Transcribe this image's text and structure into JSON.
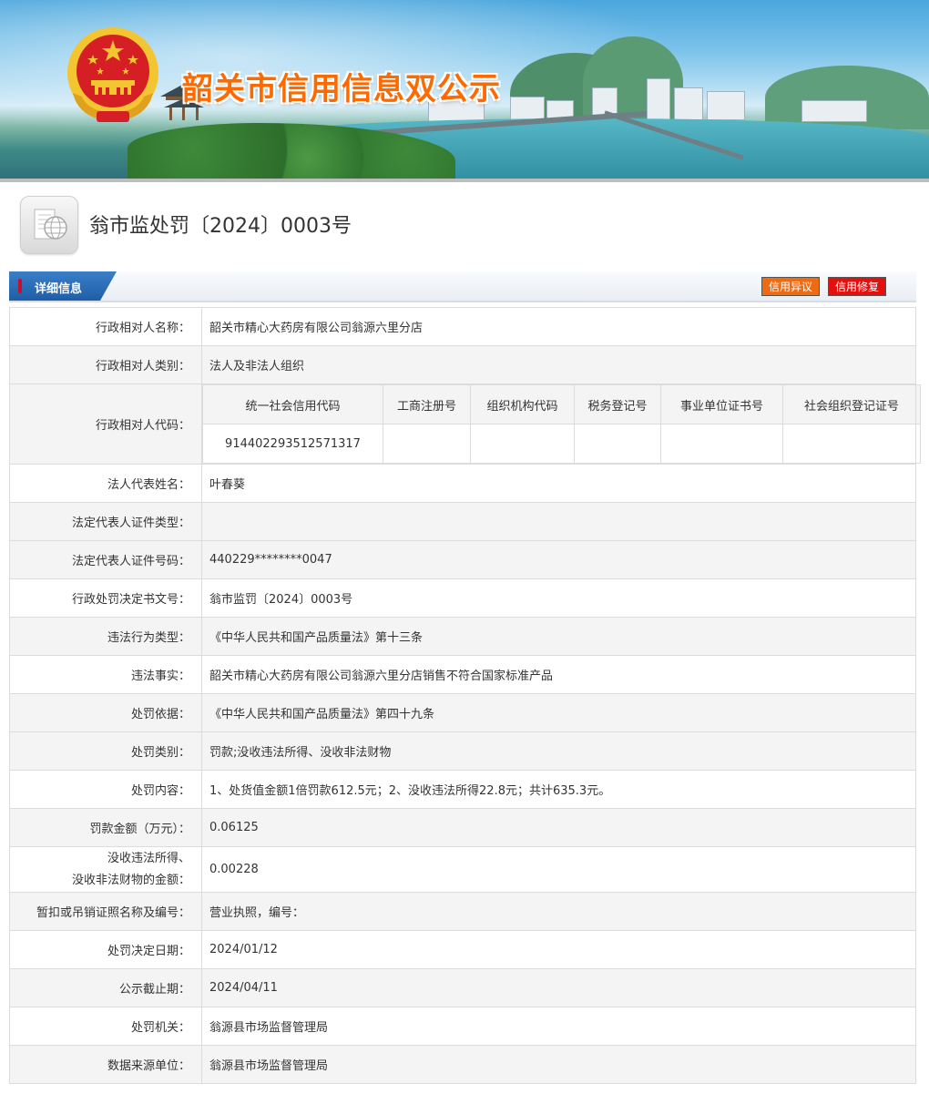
{
  "banner": {
    "title": "韶关市信用信息双公示"
  },
  "page": {
    "title": "翁市监处罚〔2024〕0003号"
  },
  "section": {
    "tab_label": "详细信息",
    "btn_objection": "信用异议",
    "btn_repair": "信用修复"
  },
  "code_table": {
    "headers": [
      "统一社会信用代码",
      "工商注册号",
      "组织机构代码",
      "税务登记号",
      "事业单位证书号",
      "社会组织登记证号"
    ],
    "values": [
      "914402293512571317",
      "",
      "",
      "",
      "",
      ""
    ]
  },
  "rows": [
    {
      "label": "行政相对人名称：",
      "value": "韶关市精心大药房有限公司翁源六里分店"
    },
    {
      "label": "行政相对人类别：",
      "value": "法人及非法人组织"
    },
    {
      "label": "行政相对人代码：",
      "value": ""
    },
    {
      "label": "法人代表姓名：",
      "value": "叶春葵"
    },
    {
      "label": "法定代表人证件类型：",
      "value": ""
    },
    {
      "label": "法定代表人证件号码：",
      "value": "440229********0047"
    },
    {
      "label": "行政处罚决定书文号：",
      "value": "翁市监罚〔2024〕0003号"
    },
    {
      "label": "违法行为类型：",
      "value": "《中华人民共和国产品质量法》第十三条"
    },
    {
      "label": "违法事实：",
      "value": "韶关市精心大药房有限公司翁源六里分店销售不符合国家标准产品"
    },
    {
      "label": "处罚依据：",
      "value": "《中华人民共和国产品质量法》第四十九条"
    },
    {
      "label": "处罚类别：",
      "value": "罚款;没收违法所得、没收非法财物"
    },
    {
      "label": "处罚内容：",
      "value": "1、处货值金额1倍罚款612.5元；2、没收违法所得22.8元；共计635.3元。"
    },
    {
      "label": "罚款金额（万元）：",
      "value": "0.06125"
    },
    {
      "label": "没收违法所得、",
      "label2": "没收非法财物的金额：",
      "value": "0.00228"
    },
    {
      "label": "暂扣或吊销证照名称及编号：",
      "value": "营业执照，编号："
    },
    {
      "label": "处罚决定日期：",
      "value": "2024/01/12"
    },
    {
      "label": "公示截止期：",
      "value": "2024/04/11"
    },
    {
      "label": "处罚机关：",
      "value": "翁源县市场监督管理局"
    },
    {
      "label": "数据来源单位：",
      "value": "翁源县市场监督管理局"
    }
  ]
}
